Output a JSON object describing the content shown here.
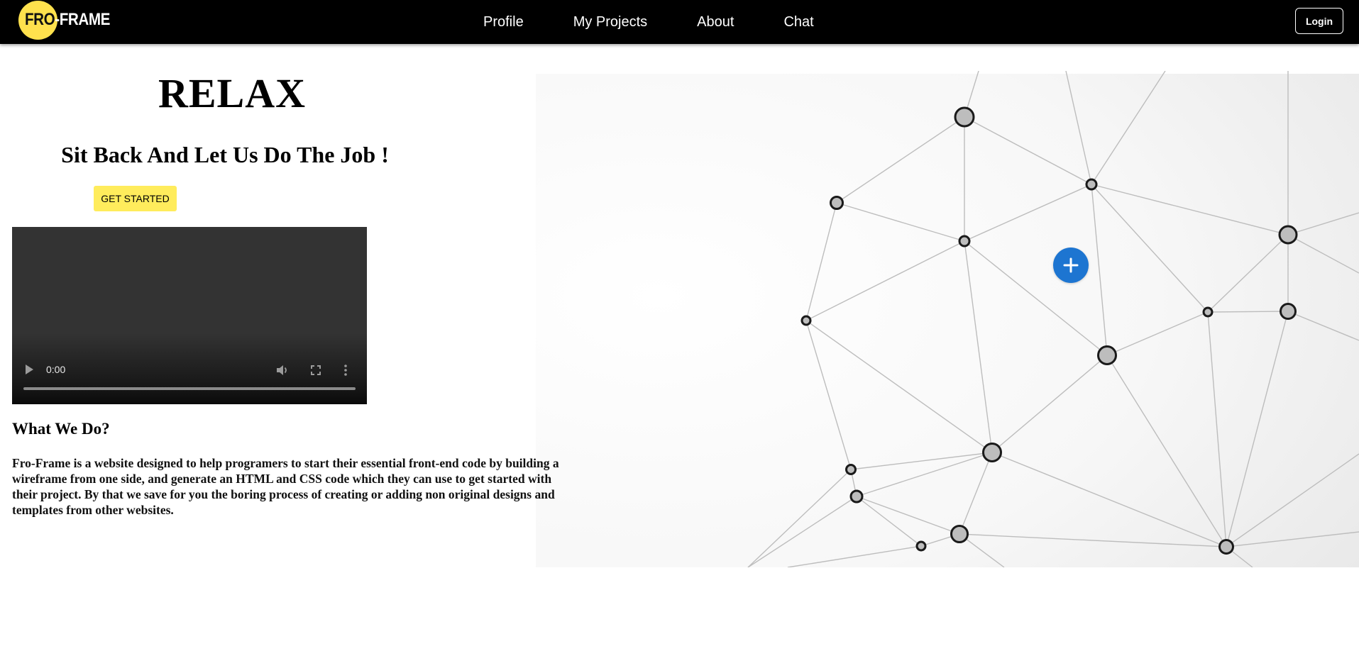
{
  "navbar": {
    "logo": {
      "part1": "FRO",
      "part2": "-FRAME",
      "color": "#ffe14d"
    },
    "links": [
      "Profile",
      "My Projects",
      "About",
      "Chat"
    ],
    "login_label": "Login"
  },
  "hero": {
    "title": "RELAX",
    "tagline": "Sit Back And Let Us Do The Job !",
    "cta_label": "GET STARTED",
    "cta_color": "#ffec5c"
  },
  "video": {
    "time": "0:00",
    "controls": [
      "play-icon",
      "volume-icon",
      "fullscreen-icon",
      "more-options-icon"
    ]
  },
  "about": {
    "heading": "What We Do?",
    "description": "Fro-Frame is a website designed to help programers to start their essential front-end code by building a wireframe from one side, and generate an HTML and CSS code which they can use to get started with their project. By that we save for you the boring process of creating or adding non original designs and templates from other websites."
  },
  "fab": {
    "icon": "plus-icon",
    "color": "#1d75d1"
  }
}
